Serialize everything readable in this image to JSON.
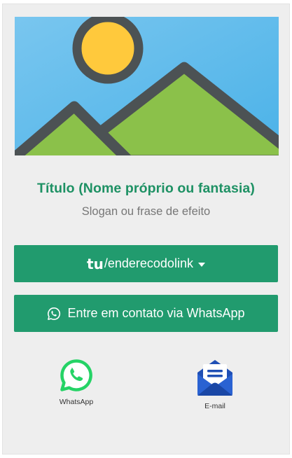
{
  "profile": {
    "title": "Título (Nome próprio ou fantasia)",
    "slogan": "Slogan ou frase de efeito"
  },
  "buttons": {
    "link_logo": "tu",
    "link_label": "/enderecodolink",
    "whatsapp_label": "Entre em contato via WhatsApp"
  },
  "contacts": [
    {
      "label": "WhatsApp",
      "icon": "whatsapp-icon"
    },
    {
      "label": "E-mail",
      "icon": "email-icon"
    }
  ],
  "colors": {
    "accent": "#219b6e",
    "title": "#1e9164",
    "background": "#eeeeee",
    "whatsapp": "#25d366",
    "email": "#1f4fb5"
  }
}
